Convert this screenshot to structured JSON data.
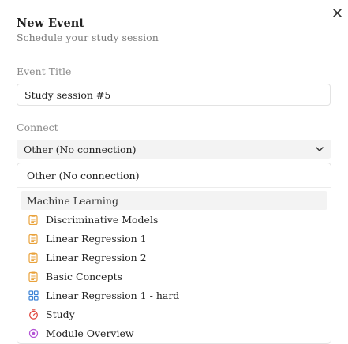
{
  "dialog": {
    "title": "New Event",
    "subtitle": "Schedule your study session"
  },
  "form": {
    "event_title_label": "Event Title",
    "event_title_value": "Study session #5",
    "connect_label": "Connect",
    "connect_selected": "Other (No connection)"
  },
  "dropdown": {
    "top_option": "Other (No connection)",
    "group_label": "Machine Learning",
    "items": [
      {
        "label": "Discriminative Models",
        "icon": "notes-icon"
      },
      {
        "label": "Linear Regression 1",
        "icon": "notes-icon"
      },
      {
        "label": "Linear Regression 2",
        "icon": "notes-icon"
      },
      {
        "label": "Basic Concepts",
        "icon": "notes-icon"
      },
      {
        "label": "Linear Regression 1 - hard",
        "icon": "grid-icon"
      },
      {
        "label": "Study",
        "icon": "timer-icon"
      },
      {
        "label": "Module Overview",
        "icon": "module-icon"
      }
    ]
  },
  "colors": {
    "notes_icon": "#e9a23b",
    "grid_icon": "#3b82d6",
    "timer_icon": "#e0463c",
    "module_icon": "#b455d6"
  }
}
